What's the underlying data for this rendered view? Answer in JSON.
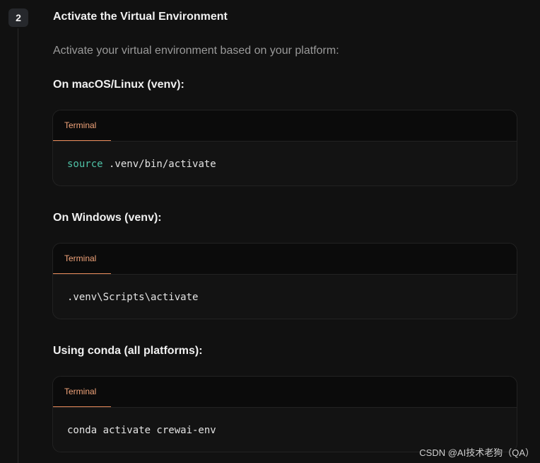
{
  "step": {
    "number": "2",
    "title": "Activate the Virtual Environment",
    "description": "Activate your virtual environment based on your platform:"
  },
  "sections": [
    {
      "heading": "On macOS/Linux (venv):",
      "tab_label": "Terminal",
      "command_keyword": "source",
      "command_rest": " .venv/bin/activate"
    },
    {
      "heading": "On Windows (venv):",
      "tab_label": "Terminal",
      "command": ".venv\\Scripts\\activate"
    },
    {
      "heading": "Using conda (all platforms):",
      "tab_label": "Terminal",
      "command": "conda activate crewai-env"
    }
  ],
  "watermark": "CSDN @AI技术老狗（QA）",
  "colors": {
    "background": "#111111",
    "tab_accent": "#f2a47a",
    "keyword": "#4fc1a6"
  }
}
